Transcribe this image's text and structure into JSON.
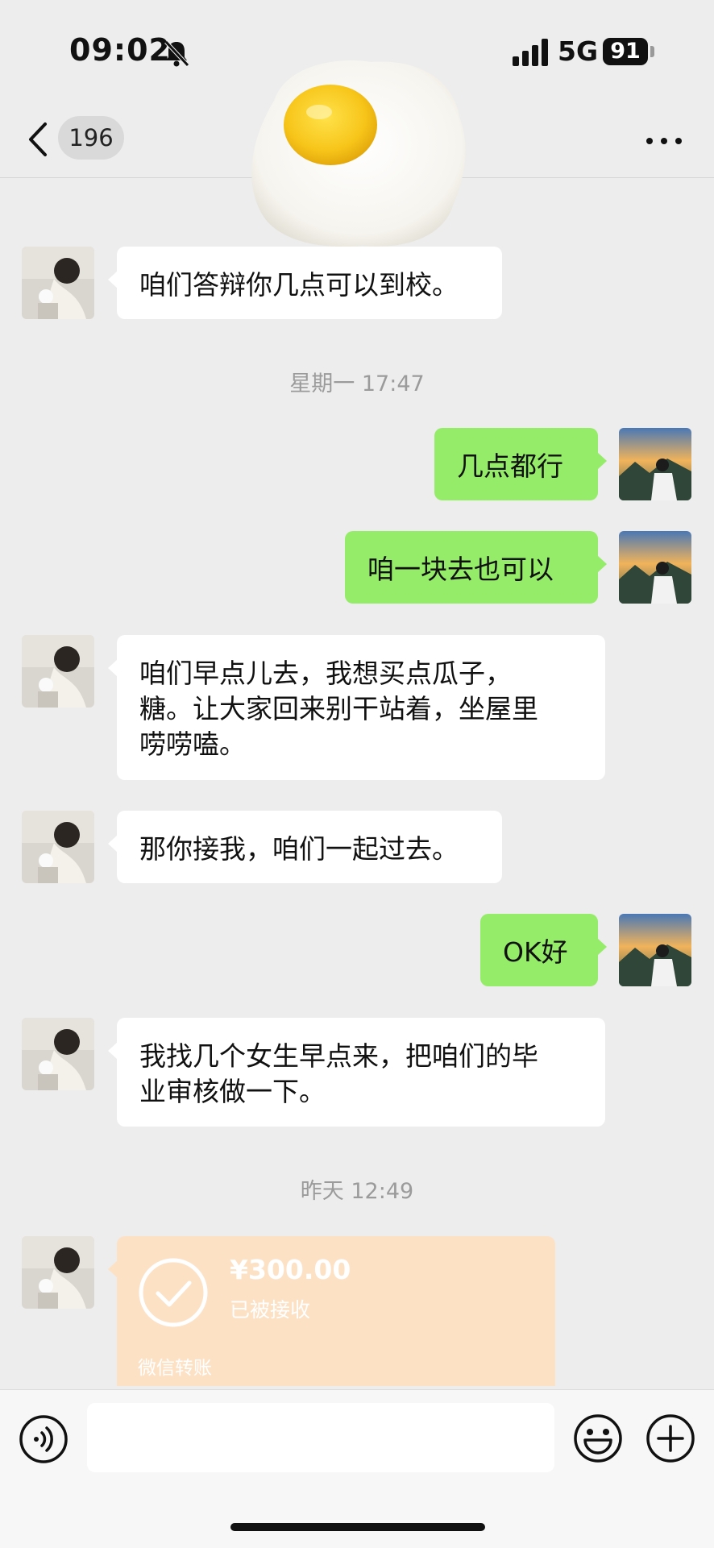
{
  "status_bar": {
    "time": "09:02",
    "network": "5G",
    "battery": "91"
  },
  "nav": {
    "unread_count": "196"
  },
  "messages": [
    {
      "side": "in",
      "text": "咱们答辩你几点可以到校。"
    },
    {
      "side": "timestamp",
      "text": "星期一 17:47"
    },
    {
      "side": "out",
      "text": "几点都行"
    },
    {
      "side": "out",
      "text": "咱一块去也可以"
    },
    {
      "side": "in",
      "text": "咱们早点儿去，我想买点瓜子，\n糖。让大家回来别干站着，坐屋里\n唠唠嗑。"
    },
    {
      "side": "in",
      "text": "那你接我，咱们一起过去。"
    },
    {
      "side": "out",
      "text": "OK好"
    },
    {
      "side": "in",
      "text": "我找几个女生早点来，把咱们的毕\n业审核做一下。"
    },
    {
      "side": "timestamp",
      "text": "昨天 12:49"
    }
  ],
  "transfer": {
    "amount": "¥300.00",
    "status": "已被接收",
    "label": "微信转账"
  },
  "colors": {
    "background": "#ededed",
    "bubble_out": "#95ec69",
    "bubble_in": "#ffffff",
    "transfer": "#fde1c5"
  }
}
